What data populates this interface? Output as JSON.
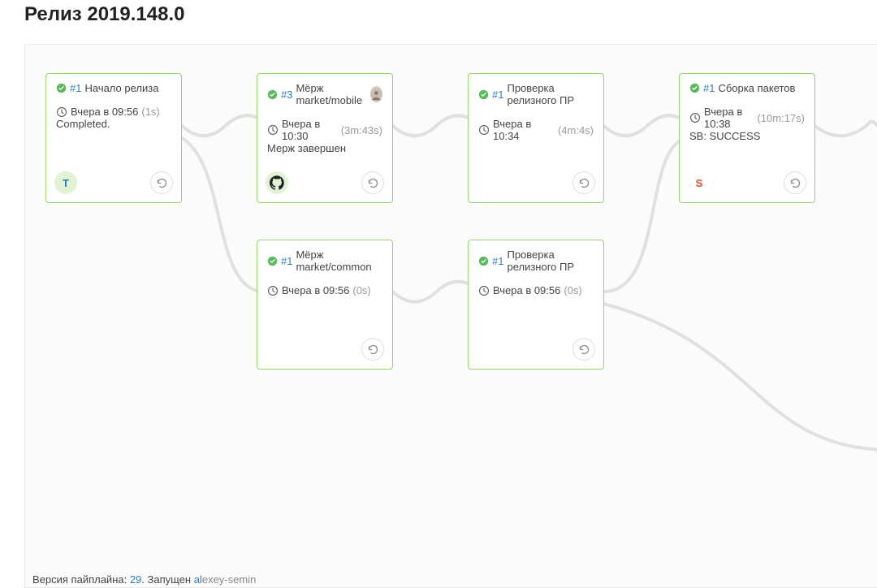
{
  "page_title": "Релиз 2019.148.0",
  "footer": {
    "pipeline_label": "Версия пайплайна: ",
    "pipeline_version": "29",
    "after_version": ". Запущен ",
    "user_first": "al",
    "user_rest": "exey-semin"
  },
  "cards": {
    "c1": {
      "num": "#1",
      "title": "Начало релиза",
      "time": "Вчера в 09:56",
      "dur": "(1s)",
      "msg": "Completed.",
      "avatar": "T",
      "avatar_color": "#2b7bbf",
      "avatar_bg": "#e2f2d4",
      "has_sm_avatar": false
    },
    "c2": {
      "num": "#3",
      "title": "Мёрж market/mobile",
      "time": "Вчера в 10:30",
      "dur": "(3m:43s)",
      "msg": "Мерж завершен",
      "avatar": "gh",
      "avatar_color": "#000",
      "avatar_bg": "#e2f2d4",
      "has_sm_avatar": true
    },
    "c3": {
      "num": "#1",
      "title": "Проверка релизного ПР",
      "time": "Вчера в 10:34",
      "dur": "(4m:4s)",
      "msg": "",
      "avatar": "",
      "avatar_color": "",
      "avatar_bg": "",
      "has_sm_avatar": false
    },
    "c4": {
      "num": "#1",
      "title": "Сборка пакетов",
      "time": "Вчера в 10:38",
      "dur": "(10m:17s)",
      "msg": "SB: SUCCESS",
      "avatar": "S",
      "avatar_color": "#e74c3c",
      "avatar_bg": "#e2f2d4",
      "has_sm_avatar": false
    },
    "c5": {
      "num": "#1",
      "title": "Мёрж market/common",
      "time": "Вчера в 09:56",
      "dur": "(0s)",
      "msg": "",
      "avatar": "",
      "avatar_color": "",
      "avatar_bg": "",
      "has_sm_avatar": false
    },
    "c6": {
      "num": "#1",
      "title": "Проверка релизного ПР",
      "time": "Вчера в 09:56",
      "dur": "(0s)",
      "msg": "",
      "avatar": "",
      "avatar_color": "",
      "avatar_bg": "",
      "has_sm_avatar": false
    }
  }
}
